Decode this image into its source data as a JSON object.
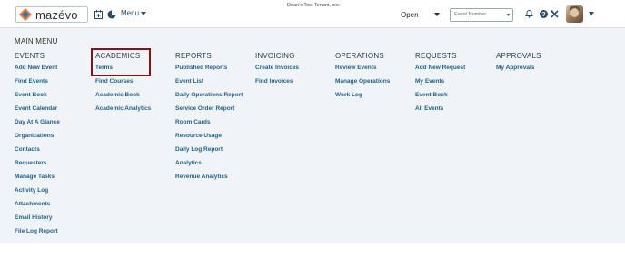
{
  "header": {
    "logo_text": "mazévo",
    "menu_label": "Menu",
    "tenant": "Dean's Test Tenant, xxx",
    "status_select": "Open",
    "event_select_placeholder": "Event Number"
  },
  "main_menu": {
    "title": "MAIN MENU",
    "columns": [
      {
        "title": "EVENTS",
        "items": [
          "Add New Event",
          "Find Events",
          "Event Book",
          "Event Calendar",
          "Day At A Glance",
          "Organizations",
          "Contacts",
          "Requesters",
          "Manage Tasks",
          "Activity Log",
          "Attachments",
          "Email History",
          "File Log Report"
        ]
      },
      {
        "title": "ACADEMICS",
        "items": [
          "Terms",
          "Find Courses",
          "Academic Book",
          "Academic Analytics"
        ]
      },
      {
        "title": "REPORTS",
        "items": [
          "Published Reports",
          "Event List",
          "Daily Operations Report",
          "Service Order Report",
          "Room Cards",
          "Resource Usage",
          "Daily Log Report",
          "Analytics",
          "Revenue Analytics"
        ]
      },
      {
        "title": "INVOICING",
        "items": [
          "Create Invoices",
          "Find Invoices"
        ]
      },
      {
        "title": "OPERATIONS",
        "items": [
          "Review Events",
          "Manage Operations",
          "Work Log"
        ]
      },
      {
        "title": "REQUESTS",
        "items": [
          "Add New Request",
          "My Events",
          "Event Book",
          "All Events"
        ]
      },
      {
        "title": "APPROVALS",
        "items": [
          "My Approvals"
        ]
      }
    ]
  },
  "colors": {
    "link": "#1f5f8b",
    "panel_bg": "#f1f4f6",
    "highlight_border": "#7b1717"
  },
  "icons": [
    "logo-diamond-icon",
    "calendar-add-icon",
    "pie-chart-icon",
    "caret-down-icon",
    "bell-icon",
    "help-icon",
    "tools-icon"
  ]
}
